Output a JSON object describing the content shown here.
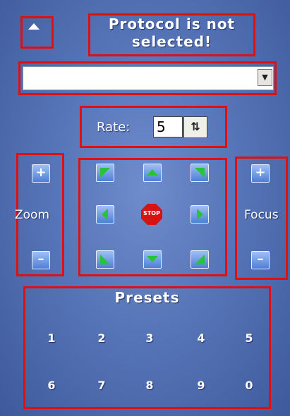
{
  "header": {
    "title_line1": "Protocol is not",
    "title_line2": "selected!"
  },
  "protocol": {
    "value": ""
  },
  "rate": {
    "label": "Rate:",
    "value": "5"
  },
  "zoom": {
    "label": "Zoom",
    "plus": "+",
    "minus": "–"
  },
  "focus": {
    "label": "Focus",
    "plus": "+",
    "minus": "–"
  },
  "ptz": {
    "stop_label": "STOP"
  },
  "presets": {
    "label": "Presets",
    "buttons": [
      "1",
      "2",
      "3",
      "4",
      "5",
      "6",
      "7",
      "8",
      "9",
      "0"
    ]
  },
  "colors": {
    "accent": "#e01010",
    "panel": "#5675b8",
    "button": "#6b97e6",
    "arrow": "#27c43a",
    "stop": "#d81212"
  }
}
